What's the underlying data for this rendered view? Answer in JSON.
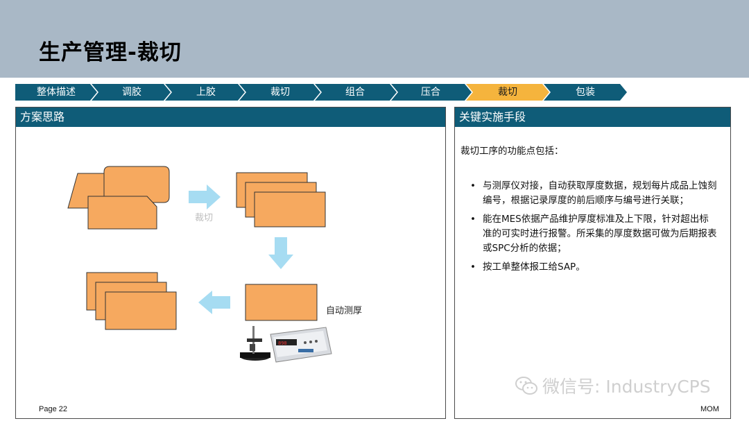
{
  "header": {
    "title": "生产管理-裁切"
  },
  "process": {
    "steps": [
      {
        "label": "整体描述"
      },
      {
        "label": "调胶"
      },
      {
        "label": "上胶"
      },
      {
        "label": "裁切"
      },
      {
        "label": "组合"
      },
      {
        "label": "压合"
      },
      {
        "label": "裁切",
        "active": true
      },
      {
        "label": "包装"
      }
    ],
    "colors": {
      "inactive": "#0f5c78",
      "active": "#f5b43d"
    }
  },
  "left_panel": {
    "title": "方案思路",
    "diagram": {
      "arrow_label_cut": "裁切",
      "label_thickness": "自动测厚",
      "sheet_color": "#f6a95f",
      "arrow_color": "#a6dcf2"
    }
  },
  "right_panel": {
    "title": "关键实施手段",
    "intro": "裁切工序的功能点包括：",
    "bullets": [
      {
        "text": "与测厚仪对接，自动获取厚度数据，规划每片成品上蚀刻编号，根据记录厚度的前后顺序与编号进行关联；"
      },
      {
        "text": "能在MES依据产品维护厚度标准及上下限，针对超出标准的可实时进行报警。所采集的厚度数据可做为后期报表或SPC分析的依据；"
      },
      {
        "text": "按工单整体报工给SAP。"
      }
    ]
  },
  "footer": {
    "page": "Page 22",
    "code": "MOM"
  },
  "watermark": {
    "text": "微信号: IndustryCPS"
  }
}
